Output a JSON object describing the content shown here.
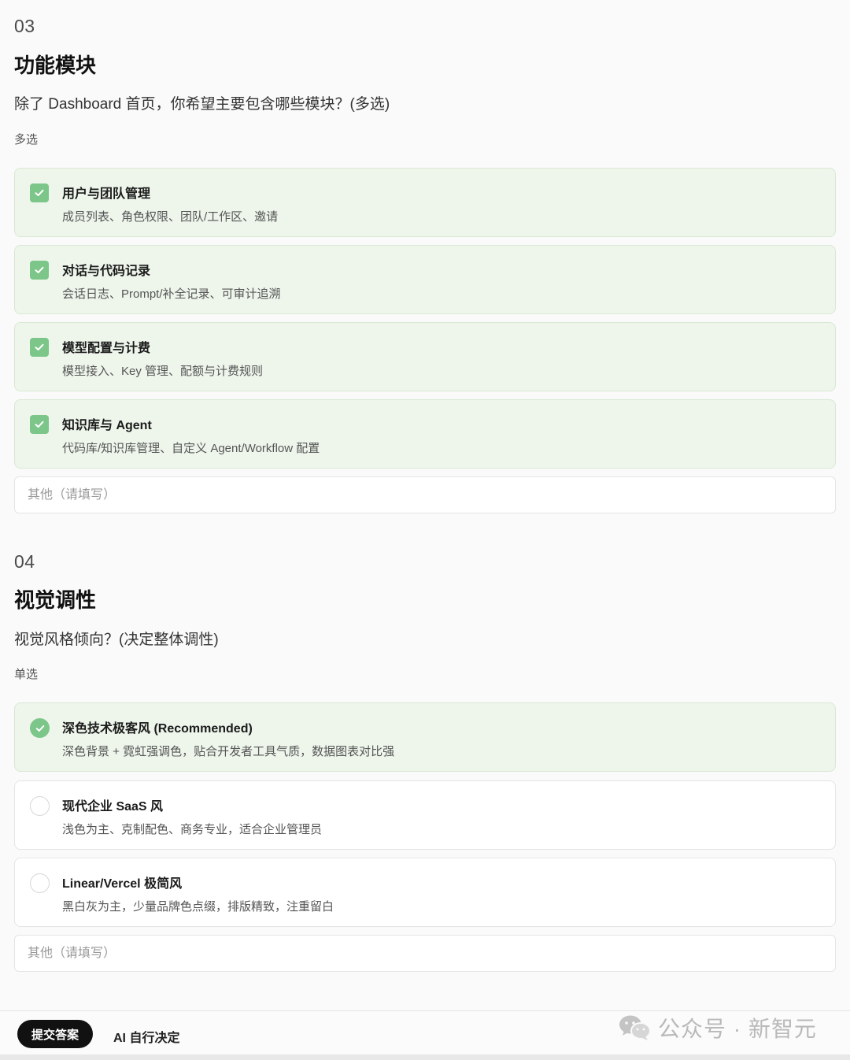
{
  "q3": {
    "number": "03",
    "title": "功能模块",
    "question": "除了 Dashboard 首页，你希望主要包含哪些模块？(多选)",
    "mode": "多选",
    "options": [
      {
        "title": "用户与团队管理",
        "desc": "成员列表、角色权限、团队/工作区、邀请",
        "checked": true
      },
      {
        "title": "对话与代码记录",
        "desc": "会话日志、Prompt/补全记录、可审计追溯",
        "checked": true
      },
      {
        "title": "模型配置与计费",
        "desc": "模型接入、Key 管理、配额与计费规则",
        "checked": true
      },
      {
        "title": "知识库与 Agent",
        "desc": "代码库/知识库管理、自定义 Agent/Workflow 配置",
        "checked": true
      }
    ],
    "other_placeholder": "其他（请填写）"
  },
  "q4": {
    "number": "04",
    "title": "视觉调性",
    "question": "视觉风格倾向？(决定整体调性)",
    "mode": "单选",
    "options": [
      {
        "title": "深色技术极客风 (Recommended)",
        "desc": "深色背景 + 霓虹强调色，贴合开发者工具气质，数据图表对比强",
        "selected": true
      },
      {
        "title": "现代企业 SaaS 风",
        "desc": "浅色为主、克制配色、商务专业，适合企业管理员",
        "selected": false
      },
      {
        "title": "Linear/Vercel 极简风",
        "desc": "黑白灰为主，少量品牌色点缀，排版精致，注重留白",
        "selected": false
      }
    ],
    "other_placeholder": "其他（请填写）"
  },
  "footer": {
    "submit_label": "提交答案",
    "ai_decide_label": "AI 自行决定"
  },
  "watermark": {
    "text": "公众号 · 新智元",
    "icon": "wechat-icon"
  },
  "colors": {
    "accent": "#7cc68a",
    "selected_bg": "#eef6ec"
  }
}
